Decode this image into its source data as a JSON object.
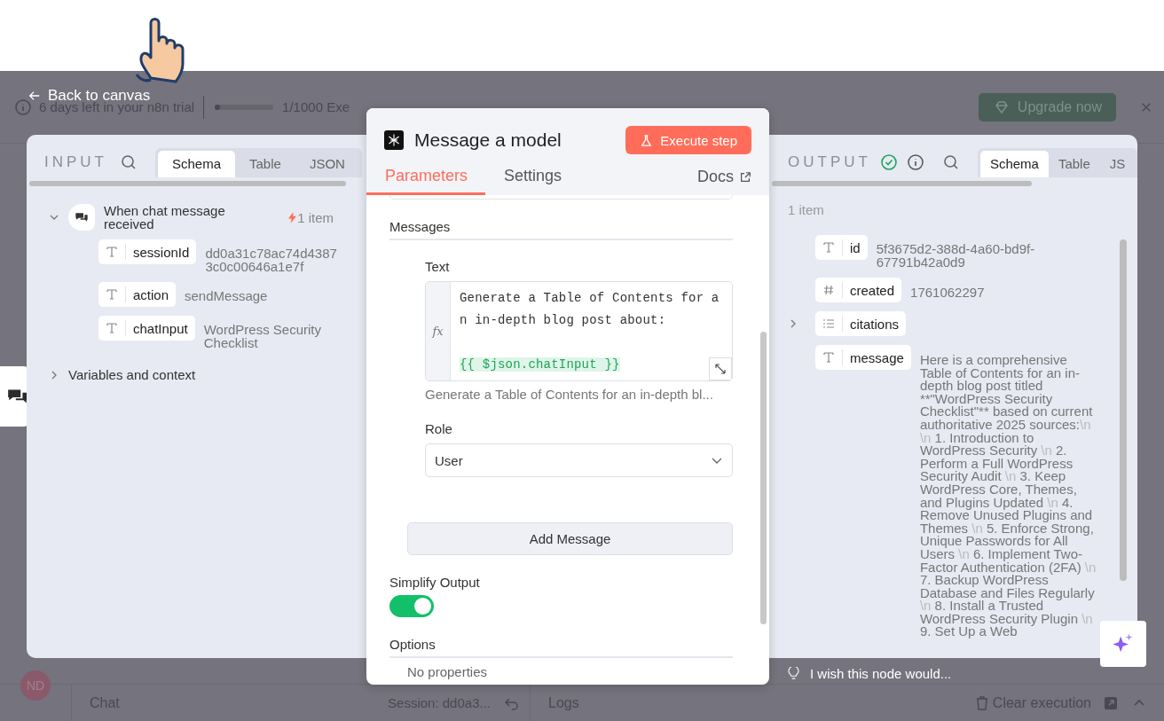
{
  "back_link": "Back to canvas",
  "trial_bar": {
    "notice": "6 days left in your n8n trial",
    "level": 0.03,
    "executions": "1/1000 Exe",
    "upgrade_button": "Upgrade now"
  },
  "input_panel": {
    "title": "INPUT",
    "tabs": [
      {
        "label": "Schema",
        "selected": true
      },
      {
        "label": "Table",
        "selected": false
      },
      {
        "label": "JSON",
        "selected": false
      }
    ],
    "tree": [
      {
        "kind": "node",
        "label": "When chat message received",
        "count": "1 item",
        "expanded": true,
        "children": [
          {
            "kind": "string",
            "name": "sessionId",
            "value": "dd0a31c78ac74d43873c0c00646a1e7f"
          },
          {
            "kind": "string",
            "name": "action",
            "value": "sendMessage"
          },
          {
            "kind": "string",
            "name": "chatInput",
            "value": "WordPress Security Checklist"
          }
        ]
      },
      {
        "kind": "group",
        "label": "Variables and context",
        "expanded": false
      }
    ]
  },
  "node_panel": {
    "title": "Message a model",
    "execute_button": "Execute step",
    "tabs": [
      {
        "label": "Parameters",
        "selected": true
      },
      {
        "label": "Settings",
        "selected": false
      }
    ],
    "docs_link": "Docs",
    "messages_heading": "Messages",
    "text_label": "Text",
    "editor": {
      "gutter_label": "fx",
      "text": "Generate a Table of Contents for an in-depth blog post about:",
      "expression": "{{ $json.chatInput }}"
    },
    "preview": "Generate a Table of Contents for an in-depth bl...",
    "role_label": "Role",
    "role_select": "User",
    "add_button": "Add Message",
    "simplify_label": "Simplify Output",
    "simplify_on": true,
    "options_heading": "Options",
    "options_empty": "No properties"
  },
  "output_panel": {
    "title": "OUTPUT",
    "success": true,
    "tabs": [
      {
        "label": "Schema",
        "selected": true
      },
      {
        "label": "Table",
        "selected": false
      },
      {
        "label": "JS",
        "selected": false
      }
    ],
    "count": "1 item",
    "fields": [
      {
        "kind": "string",
        "name": "id",
        "value": "5f3675d2-388d-4a60-bd9f-67791b42a0d9"
      },
      {
        "kind": "number",
        "name": "created",
        "value": "1761062297"
      },
      {
        "kind": "array",
        "name": "citations",
        "expanded": false
      },
      {
        "kind": "string",
        "name": "message",
        "value": "Here is a comprehensive Table of Contents for an in-depth blog post titled **\"WordPress Security Checklist\"** based on current authoritative 2025 sources:\\n \\n 1. Introduction to WordPress Security \\n 2. Perform a Full WordPress Security Audit \\n 3. Keep WordPress Core, Themes, and Plugins Updated \\n 4. Remove Unused Plugins and Themes \\n 5. Enforce Strong, Unique Passwords for All Users \\n 6. Implement Two-Factor Authentication (2FA) \\n 7. Backup WordPress Database and Files Regularly \\n 8. Install a Trusted WordPress Security Plugin \\n 9. Set Up a Web"
      }
    ]
  },
  "feedback_prompt": "I wish this node would...",
  "bottom_bar": {
    "avatar": "ND",
    "chat": "Chat",
    "session": "Session: dd0a3...",
    "logs": "Logs",
    "clear": "Clear execution"
  }
}
